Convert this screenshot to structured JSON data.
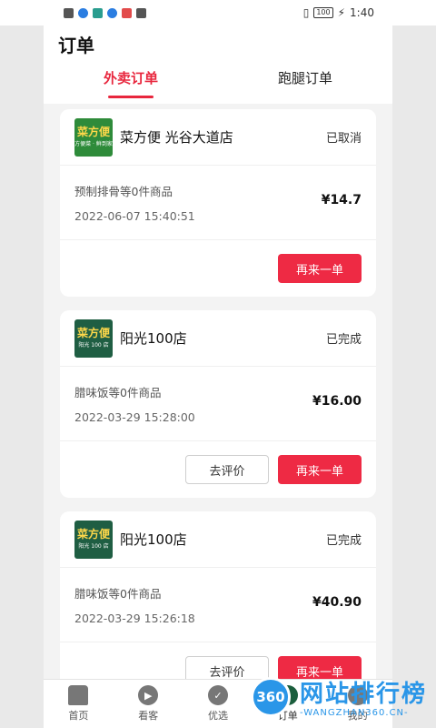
{
  "status_bar": {
    "battery": "100",
    "time": "1:40"
  },
  "header": {
    "title": "订单"
  },
  "tabs": [
    {
      "label": "外卖订单",
      "active": true
    },
    {
      "label": "跑腿订单",
      "active": false
    }
  ],
  "orders": [
    {
      "logo_text": "菜方便",
      "logo_sub": "方便菜 · 鲜到家",
      "shop": "菜方便 光谷大道店",
      "status": "已取消",
      "items": "预制排骨等0件商品",
      "time": "2022-06-07 15:40:51",
      "price": "¥14.7",
      "rebuy_label": "再来一单"
    },
    {
      "logo_text": "菜方便",
      "logo_sub": "阳光 100 店",
      "shop": "阳光100店",
      "status": "已完成",
      "items": "腊味饭等0件商品",
      "time": "2022-03-29 15:28:00",
      "price": "¥16.00",
      "review_label": "去评价",
      "rebuy_label": "再来一单"
    },
    {
      "logo_text": "菜方便",
      "logo_sub": "阳光 100 店",
      "shop": "阳光100店",
      "status": "已完成",
      "items": "腊味饭等0件商品",
      "time": "2022-03-29 15:26:18",
      "price": "¥40.90",
      "review_label": "去评价",
      "rebuy_label": "再来一单"
    }
  ],
  "bottom_nav": [
    {
      "label": "首页",
      "icon": "home-icon"
    },
    {
      "label": "看客",
      "icon": "play-icon"
    },
    {
      "label": "优选",
      "icon": "check-icon"
    },
    {
      "label": "订单",
      "icon": "order-icon",
      "active": true
    },
    {
      "label": "我的",
      "icon": "user-icon"
    }
  ],
  "watermark": {
    "badge": "360",
    "text": "网站排行榜",
    "url": "-WANGZHAN360.CN-"
  },
  "colors": {
    "accent": "#e8263d",
    "button": "#ee2a44",
    "brand_green": "#2e8b3a"
  }
}
